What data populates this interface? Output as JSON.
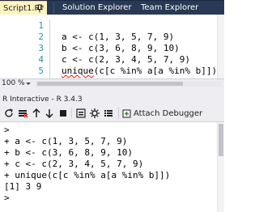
{
  "tabs": {
    "active": "Script1.R*",
    "solution_explorer": "Solution Explorer",
    "team_explorer": "Team Explorer"
  },
  "editor": {
    "line_numbers": [
      "1",
      "2",
      "3",
      "4",
      "5"
    ],
    "lines": [
      "",
      "a <- c(1, 3, 5, 7, 9)",
      "b <- c(3, 6, 8, 9, 10)",
      "c <- c(2, 3, 4, 5, 7, 9)",
      "unique(c[c %in% a[a %in% b]])"
    ],
    "squiggle_word": "unique"
  },
  "zoom": {
    "value": "100 %"
  },
  "r_interactive": {
    "title": "R Interactive - R 3.4.3",
    "attach_label": "Attach Debugger",
    "console": [
      {
        "prompt": ">",
        "text": ""
      },
      {
        "prompt": ">",
        "text": "a <- c(1, 3, 5, 7, 9)"
      },
      {
        "prompt": ">",
        "text": "b <- c(3, 6, 8, 9, 10)"
      },
      {
        "prompt": ">",
        "text": "c <- c(2, 3, 4, 5, 7, 9)"
      },
      {
        "prompt": ">",
        "text": "unique(c[c %in% a[a %in% b]])"
      },
      {
        "prompt": "",
        "text": "[1] 3 9"
      },
      {
        "prompt": ">",
        "text": ""
      }
    ]
  },
  "colors": {
    "tabstrip": "#293955",
    "active_tab": "#fdf4bf",
    "line_number": "#2b91af",
    "squiggle": "#e51400"
  },
  "icons": {
    "pin": "pin-icon",
    "toolbar": [
      "refresh-icon",
      "clear-icon",
      "history-up-icon",
      "history-down-icon",
      "stop-icon",
      "workspace-icon",
      "settings-icon",
      "list-icon"
    ],
    "attach": "attach-debugger-icon"
  }
}
